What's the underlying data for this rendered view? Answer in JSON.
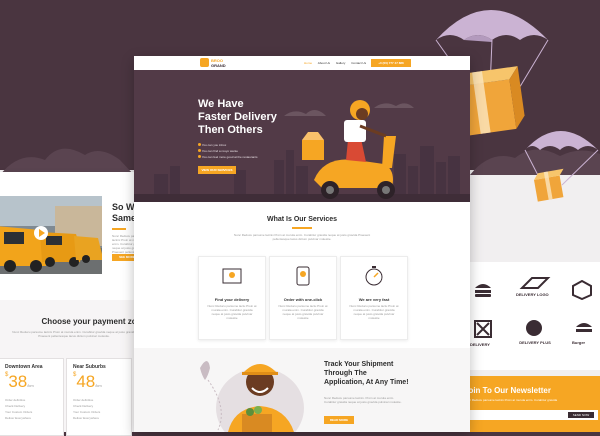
{
  "header": {
    "logo_line1": "BROO",
    "logo_line2": "GRAND",
    "nav": [
      "Home",
      "About Us",
      "Gallery",
      "Contact Us"
    ],
    "phone": "+0 (00) 777 47 888"
  },
  "hero": {
    "title_line1": "We Have",
    "title_line2": "Faster Delivery",
    "title_line3": "Then Others",
    "bullets": [
      "You can you inbox",
      "You can find a rouyo wante",
      "You can feel more good at the restaurants"
    ],
    "cta": "VIEW OUR SERVICES"
  },
  "services": {
    "heading": "What Is Our Services",
    "intro": "Nunc Reducu parsume lacinix Proin at murula enim. Curabitur gravida neque at justo gravida Praesent pellentesque lacus dictum pulvinar molestie.",
    "items": [
      {
        "icon": "map-parcel-icon",
        "title": "Find your delivery",
        "text": "Nunc Reducu parsume lactu Proin at murala enim. Curabitur gravida neque at justo gravida pulvinar molestie"
      },
      {
        "icon": "phone-click-icon",
        "title": "Order with one-click",
        "text": "Nunc Reducu parsume lactu Proin at murala enim. Curabitur gravida neque at justo gravida pulvinar molestie"
      },
      {
        "icon": "stopwatch-icon",
        "title": "We are very fast",
        "text": "Nunc Reducu parsume lactu Proin at murala enim. Curabitur gravida neque at justo gravida pulvinar molestie"
      }
    ]
  },
  "track": {
    "line1": "Track Your Shipment",
    "line2": "Through The",
    "line3": "Application, At Any Time!",
    "text": "Nunc Reducu parsume lacinix. Proin at murula enim. Curabitur gravida neque at justo gravida pulvinar molestie.",
    "cta": "READ MORE"
  },
  "left": {
    "heading_line1": "So Wha",
    "heading_line2": "Same-",
    "body": "Nunc Reducu parsume lacinix Proin at murula enim. Curabitur gravida neque at justo gravida Praesent pellentesque lacus.",
    "cta": "SEE MORE",
    "pay_heading": "Choose your payment zone",
    "pay_intro": "Nunc Reducu parsume lacinix Proin at murula enim. Curabitur gravida neque at justo gravida Praesent pellentesque lacus dictum pulvinar molestie.",
    "zones": [
      {
        "name": "Downtown Area",
        "currency": "$",
        "price": "38",
        "unit": "/km",
        "rows": [
          "Order definitive",
          "Check Delivery",
          "Your Custom Orders",
          "Deliver Everywhere"
        ]
      },
      {
        "name": "Near Suburbs",
        "currency": "$",
        "price": "48",
        "unit": "/km",
        "rows": [
          "Order definitive",
          "Check Delivery",
          "Your Custom Orders",
          "Deliver Everywhere"
        ]
      }
    ]
  },
  "right": {
    "logos": [
      "DELIVERY LOGO",
      "DELIVERY",
      "DELIVERY PLUS",
      "Burger"
    ],
    "newsletter_title": "Join To Our Newsletter",
    "newsletter_text": "Nunc Reducu parsume lacinix Proin at murula enim. Curabitur gravida",
    "newsletter_button": "SEND NOW"
  },
  "colors": {
    "brand": "#f6a623",
    "dark": "#4a3540"
  }
}
